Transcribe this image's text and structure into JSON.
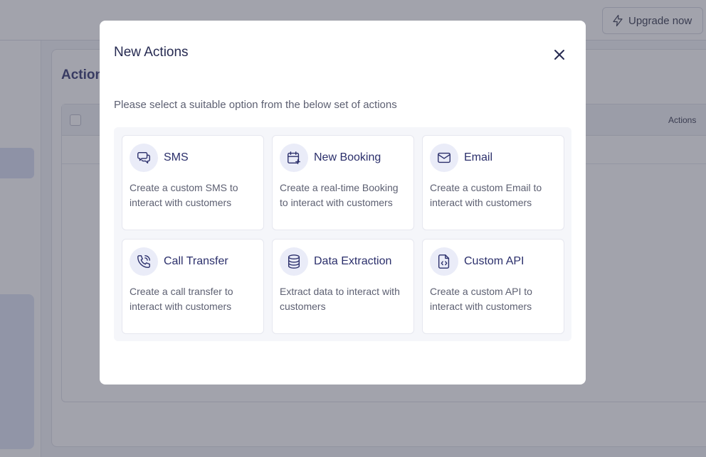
{
  "header": {
    "upgrade_label": "Upgrade now"
  },
  "content": {
    "title": "Actions",
    "table": {
      "actions_column": "Actions"
    }
  },
  "modal": {
    "title": "New Actions",
    "subtitle": "Please select a suitable option from the below set of actions",
    "options": [
      {
        "title": "SMS",
        "description": "Create a custom SMS to interact with customers",
        "icon": "sms-chat-icon"
      },
      {
        "title": "New Booking",
        "description": "Create a real-time Booking to interact with customers",
        "icon": "calendar-plus-icon"
      },
      {
        "title": "Email",
        "description": "Create a custom Email to interact with customers",
        "icon": "mail-icon"
      },
      {
        "title": "Call Transfer",
        "description": "Create a call transfer to interact with customers",
        "icon": "phone-ringing-icon"
      },
      {
        "title": "Data Extraction",
        "description": "Extract data to interact with customers",
        "icon": "database-icon"
      },
      {
        "title": "Custom API",
        "description": "Create a custom API to interact with customers",
        "icon": "code-file-icon"
      }
    ]
  },
  "colors": {
    "accent": "#2b2f6b",
    "icon_bg": "#eaecf8",
    "overlay": "rgba(70,72,90,0.5)"
  }
}
